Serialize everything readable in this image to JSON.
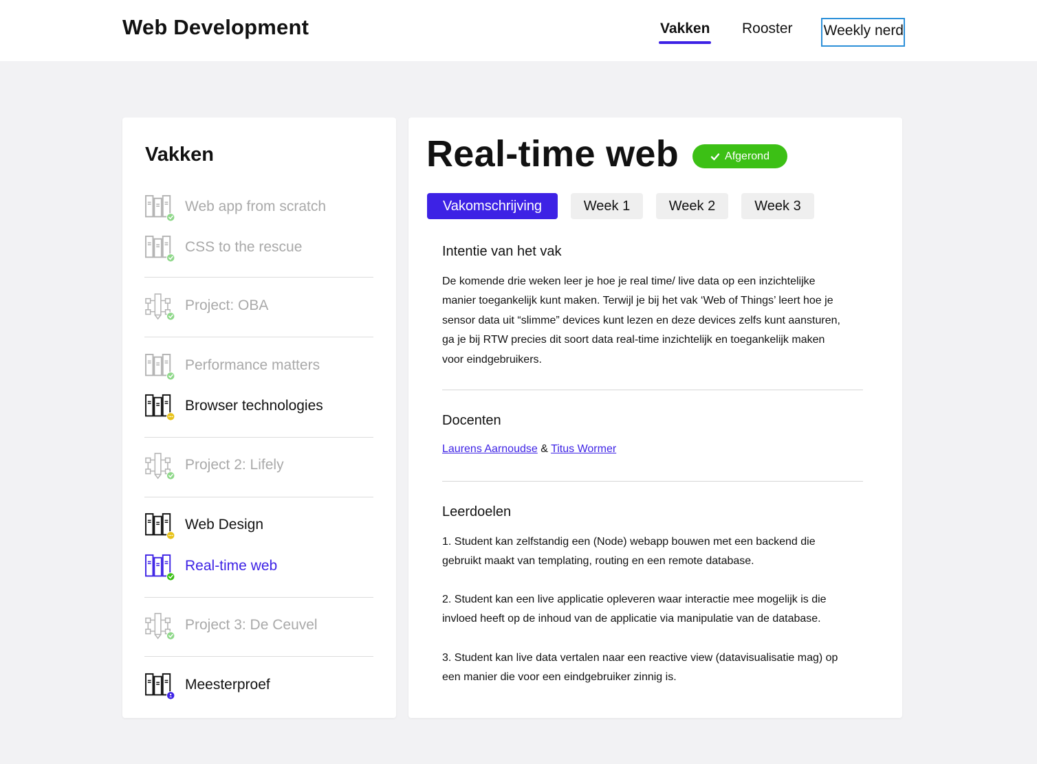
{
  "header": {
    "title": "Web Development",
    "nav": [
      {
        "label": "Vakken",
        "state": "active"
      },
      {
        "label": "Rooster",
        "state": "normal"
      },
      {
        "label": "Weekly nerd",
        "state": "focused"
      }
    ]
  },
  "sidebar": {
    "title": "Vakken",
    "items": [
      {
        "label": "Web app from scratch",
        "status": "done",
        "icon": "books-icon"
      },
      {
        "label": "CSS to the rescue",
        "status": "done",
        "icon": "books-icon"
      },
      {
        "label": "Project: OBA",
        "status": "done",
        "icon": "project-tools-icon"
      },
      {
        "label": "Performance matters",
        "status": "done",
        "icon": "books-icon"
      },
      {
        "label": "Browser technologies",
        "status": "in-progress",
        "icon": "books-icon"
      },
      {
        "label": "Project 2: Lifely",
        "status": "done",
        "icon": "project-tools-icon"
      },
      {
        "label": "Web Design",
        "status": "in-progress",
        "icon": "books-icon"
      },
      {
        "label": "Real-time web",
        "status": "current",
        "icon": "books-icon"
      },
      {
        "label": "Project 3: De Ceuvel",
        "status": "done",
        "icon": "project-tools-icon"
      },
      {
        "label": "Meesterproef",
        "status": "upcoming",
        "icon": "books-icon"
      }
    ]
  },
  "main": {
    "title": "Real-time web",
    "badge": "Afgerond",
    "tabs": [
      "Vakomschrijving",
      "Week 1",
      "Week 2",
      "Week 3"
    ],
    "active_tab": 0,
    "intent": {
      "heading": "Intentie van het vak",
      "lines": [
        "De komende drie weken leer je hoe je real time/ live data op een inzichtelijke",
        "manier toegankelijk kunt maken. Terwijl je bij het vak ‘Web of Things’ leert hoe je",
        "sensor data uit “slimme” devices kunt lezen en deze devices zelfs kunt aansturen,",
        "ga je bij RTW precies dit soort data real-time inzichtelijk en toegankelijk maken",
        "voor eindgebruikers."
      ]
    },
    "teachers": {
      "heading": "Docenten",
      "teacher1": "Laurens Aarnoudse",
      "separator": "&",
      "teacher2": "Titus Wormer"
    },
    "goals": {
      "heading": "Leerdoelen",
      "items": [
        [
          "1. Student kan zelfstandig een (Node) webapp bouwen met een backend die",
          "gebruikt maakt van templating, routing en een remote database."
        ],
        [
          "2. Student kan een live applicatie opleveren waar interactie mee mogelijk is die",
          "invloed heeft op de inhoud van de applicatie via manipulatie van de database."
        ],
        [
          "3. Student kan live data vertalen naar een reactive view (datavisualisatie mag) op",
          "een manier die voor een eindgebruiker zinnig is."
        ]
      ]
    }
  },
  "colors": {
    "accent": "#3d22e5",
    "done": "#8fd88a",
    "done_strong": "#3cc015",
    "in_progress": "#e8c31a",
    "muted_text": "#a9a9a9",
    "background": "#f2f2f4"
  }
}
